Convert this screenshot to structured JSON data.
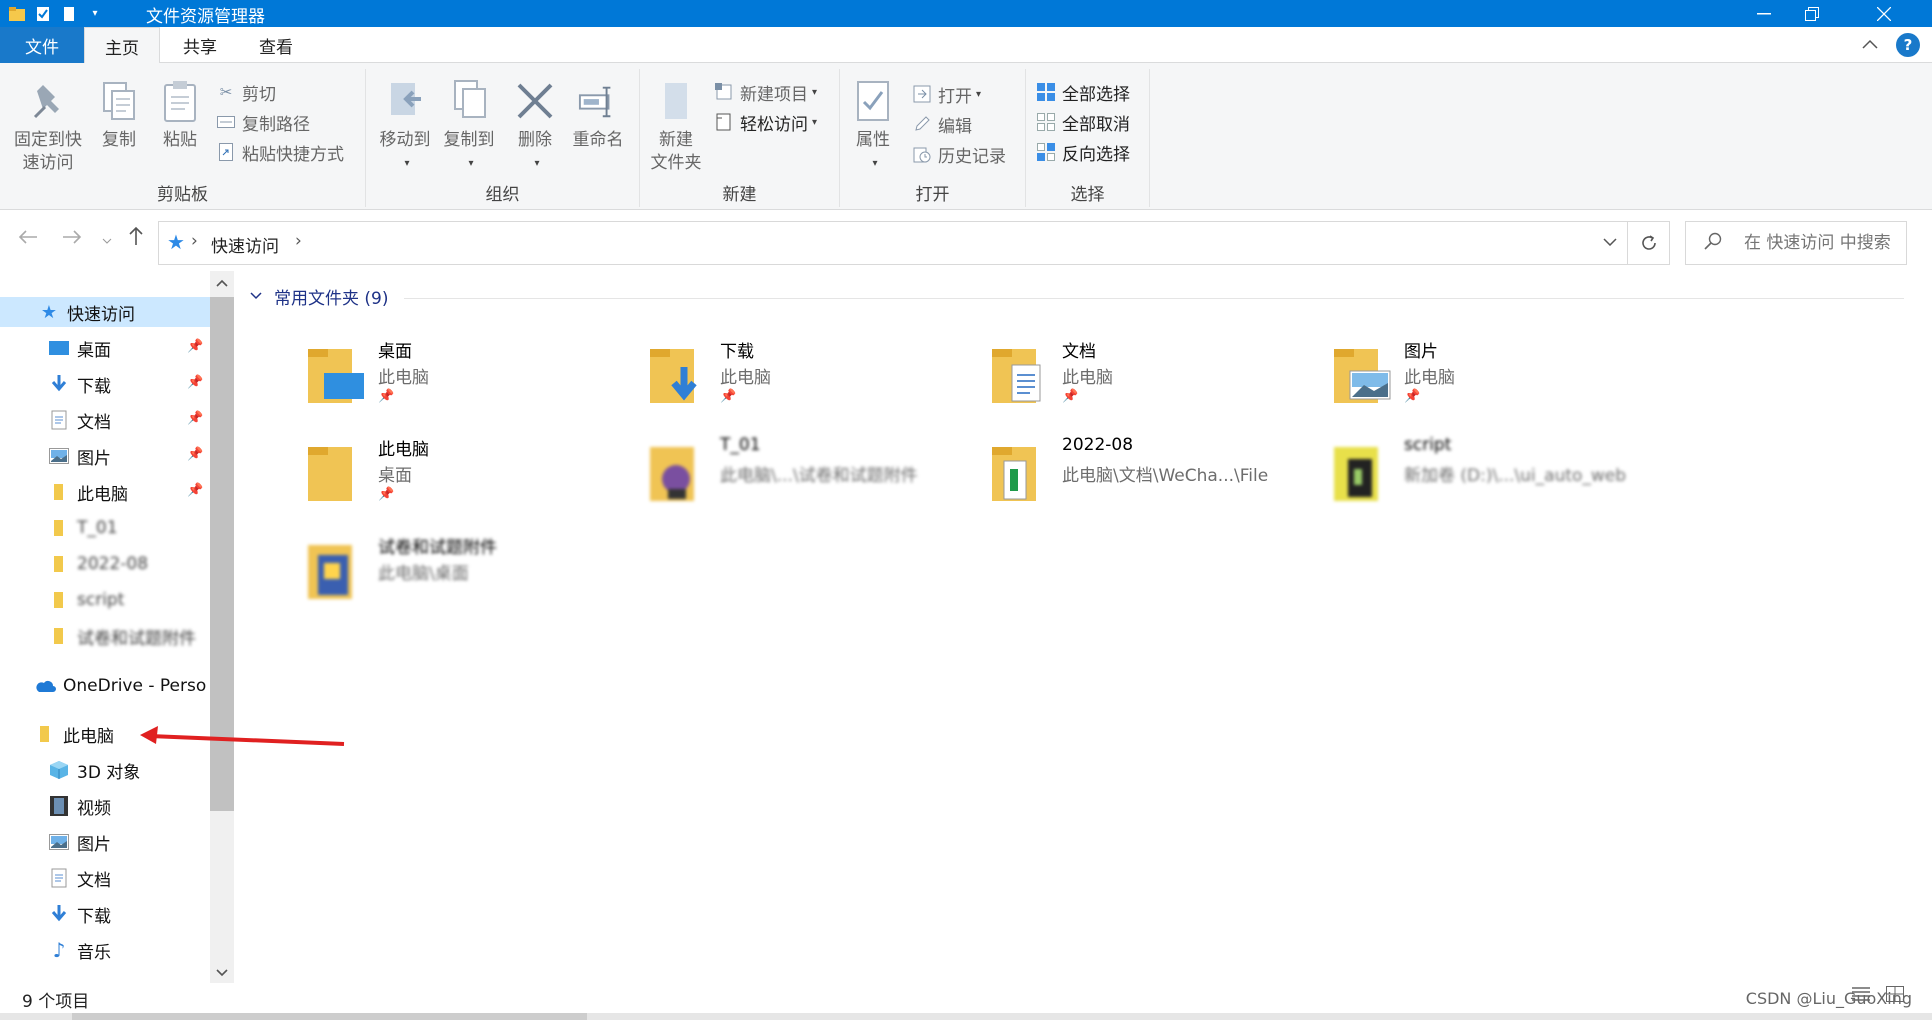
{
  "window": {
    "title": "文件资源管理器"
  },
  "ribbon_tabs": {
    "file": "文件",
    "home": "主页",
    "share": "共享",
    "view": "查看",
    "help": "?"
  },
  "ribbon": {
    "clipboard": {
      "label": "剪贴板",
      "pin_quick_access": "固定到快\n速访问",
      "copy": "复制",
      "paste": "粘贴",
      "cut": "剪切",
      "copy_path": "复制路径",
      "paste_shortcut": "粘贴快捷方式"
    },
    "organize": {
      "label": "组织",
      "move_to": "移动到",
      "copy_to": "复制到",
      "delete": "删除",
      "rename": "重命名"
    },
    "new": {
      "label": "新建",
      "new_folder": "新建\n文件夹",
      "new_item": "新建项目",
      "easy_access": "轻松访问"
    },
    "open": {
      "label": "打开",
      "properties": "属性",
      "open": "打开",
      "edit": "编辑",
      "history": "历史记录"
    },
    "select": {
      "label": "选择",
      "select_all": "全部选择",
      "select_none": "全部取消",
      "invert": "反向选择"
    }
  },
  "address": {
    "breadcrumb": "快速访问",
    "search_placeholder": "在 快速访问 中搜索"
  },
  "nav_pane": {
    "quick_access": "快速访问",
    "quick_items": [
      {
        "label": "桌面",
        "icon": "desktop-icon"
      },
      {
        "label": "下载",
        "icon": "download-icon"
      },
      {
        "label": "文档",
        "icon": "document-icon"
      },
      {
        "label": "图片",
        "icon": "pictures-icon"
      },
      {
        "label": "此电脑",
        "icon": "folder-icon"
      },
      {
        "label": "T_01",
        "icon": "folder-icon"
      },
      {
        "label": "2022-08",
        "icon": "folder-icon"
      },
      {
        "label": "script",
        "icon": "folder-icon"
      },
      {
        "label": "试卷和试题附件",
        "icon": "folder-icon"
      }
    ],
    "onedrive": "OneDrive - Perso",
    "this_pc": "此电脑",
    "pc_items": [
      {
        "label": "3D 对象",
        "icon": "3d-objects-icon"
      },
      {
        "label": "视频",
        "icon": "video-icon"
      },
      {
        "label": "图片",
        "icon": "pictures-icon"
      },
      {
        "label": "文档",
        "icon": "document-icon"
      },
      {
        "label": "下载",
        "icon": "download-icon"
      },
      {
        "label": "音乐",
        "icon": "music-icon"
      }
    ]
  },
  "content": {
    "group_title": "常用文件夹 (9)",
    "tiles": [
      {
        "name": "桌面",
        "sub": "此电脑",
        "icon": "desktop-folder-icon"
      },
      {
        "name": "下载",
        "sub": "此电脑",
        "icon": "download-folder-icon"
      },
      {
        "name": "文档",
        "sub": "此电脑",
        "icon": "document-folder-icon"
      },
      {
        "name": "图片",
        "sub": "此电脑",
        "icon": "pictures-folder-icon"
      },
      {
        "name": "此电脑",
        "sub": "桌面",
        "icon": "folder-icon"
      },
      {
        "name": "T_01",
        "sub": "此电脑\\...\\试卷和试题附件",
        "icon": "folder-icon"
      },
      {
        "name": "2022-08",
        "sub": "此电脑\\文档\\WeCha...\\File",
        "icon": "folder-icon"
      },
      {
        "name": "script",
        "sub": "新加卷 (D:)\\...\\ui_auto_web",
        "icon": "folder-icon"
      },
      {
        "name": "试卷和试题附件",
        "sub": "此电脑\\桌面",
        "icon": "folder-icon"
      }
    ]
  },
  "status": {
    "item_count": "9 个项目",
    "watermark": "CSDN @Liu_GuoXing"
  },
  "colors": {
    "titlebar": "#0078d7",
    "file_tab": "#1979ca",
    "ribbon_bg": "#f5f6f7",
    "group_header": "#1e3287",
    "annotation_arrow": "#e02020"
  }
}
